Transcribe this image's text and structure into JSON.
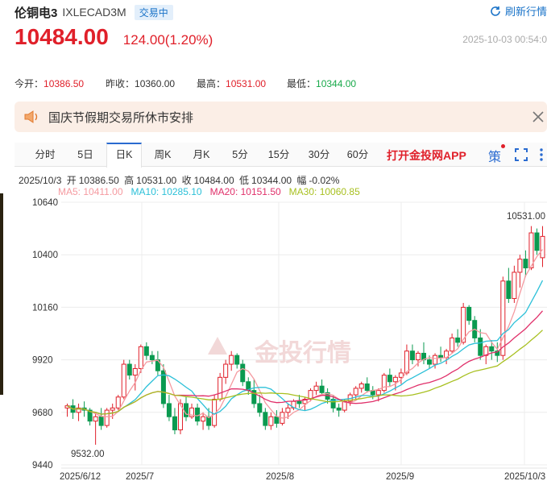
{
  "header": {
    "name": "伦铜电3",
    "code": "IXLECAD3M",
    "status": "交易中",
    "refresh_label": "刷新行情"
  },
  "quote": {
    "price": "10484.00",
    "change": "124.00(1.20%)",
    "timestamp": "2025-10-03 00:54:0"
  },
  "stats": [
    {
      "label": "今开：",
      "value": "10386.50",
      "tone": "red"
    },
    {
      "label": "昨收：",
      "value": "10360.00",
      "tone": "dark"
    },
    {
      "label": "最高：",
      "value": "10531.00",
      "tone": "red"
    },
    {
      "label": "最低：",
      "value": "10344.00",
      "tone": "green"
    }
  ],
  "notice": {
    "text": "国庆节假期交易所休市安排"
  },
  "tabs": [
    {
      "label": "分时",
      "active": false
    },
    {
      "label": "5日",
      "active": false
    },
    {
      "label": "日K",
      "active": true
    },
    {
      "label": "周K",
      "active": false
    },
    {
      "label": "月K",
      "active": false
    },
    {
      "label": "5分",
      "active": false
    },
    {
      "label": "15分",
      "active": false
    },
    {
      "label": "30分",
      "active": false
    },
    {
      "label": "60分",
      "active": false
    }
  ],
  "toolbar": {
    "app_link": "打开金投网APP",
    "strategy_label": "策"
  },
  "ohlc": {
    "date": "2025/10/3",
    "open_label": "开",
    "open": "10386.50",
    "high_label": "高",
    "high": "10531.00",
    "close_label": "收",
    "close": "10484.00",
    "low_label": "低",
    "low": "10344.00",
    "range_label": "幅",
    "range": "-0.02%"
  },
  "ma": [
    {
      "text": "MA5: 10411.00",
      "color": "#f59aa0"
    },
    {
      "text": "MA10: 10285.10",
      "color": "#2bc0d8"
    },
    {
      "text": "MA20: 10151.50",
      "color": "#e0306a"
    },
    {
      "text": "MA30: 10060.85",
      "color": "#a8c020"
    }
  ],
  "watermark": "金投行情",
  "colors": {
    "up": "#e0202a",
    "down": "#0a9a50",
    "accent": "#2a6bd0"
  },
  "chart_data": {
    "type": "candlestick",
    "ylim": [
      9440,
      10640
    ],
    "y_ticks": [
      10640,
      10400,
      10160,
      9920,
      9680,
      9440
    ],
    "x_ticks": [
      "2025/6/12",
      "2025/7",
      "2025/8",
      "2025/9",
      "2025/10/3"
    ],
    "max_label": "10531.00",
    "min_label": "9532.00",
    "candles": [
      [
        9700,
        9720,
        9660,
        9710
      ],
      [
        9710,
        9740,
        9650,
        9680
      ],
      [
        9680,
        9720,
        9640,
        9700
      ],
      [
        9700,
        9730,
        9660,
        9690
      ],
      [
        9690,
        9700,
        9620,
        9640
      ],
      [
        9640,
        9680,
        9532,
        9660
      ],
      [
        9660,
        9700,
        9600,
        9620
      ],
      [
        9620,
        9700,
        9610,
        9690
      ],
      [
        9690,
        9720,
        9650,
        9700
      ],
      [
        9700,
        9760,
        9690,
        9750
      ],
      [
        9750,
        9920,
        9740,
        9900
      ],
      [
        9900,
        9920,
        9830,
        9850
      ],
      [
        9850,
        9900,
        9780,
        9880
      ],
      [
        9880,
        9990,
        9860,
        9980
      ],
      [
        9980,
        10000,
        9920,
        9940
      ],
      [
        9940,
        9960,
        9900,
        9920
      ],
      [
        9920,
        9960,
        9850,
        9870
      ],
      [
        9870,
        9900,
        9700,
        9720
      ],
      [
        9720,
        9760,
        9640,
        9660
      ],
      [
        9660,
        9700,
        9580,
        9600
      ],
      [
        9600,
        9740,
        9580,
        9720
      ],
      [
        9720,
        9750,
        9640,
        9660
      ],
      [
        9660,
        9720,
        9650,
        9700
      ],
      [
        9700,
        9720,
        9620,
        9640
      ],
      [
        9640,
        9680,
        9600,
        9660
      ],
      [
        9660,
        9700,
        9600,
        9620
      ],
      [
        9620,
        9760,
        9610,
        9740
      ],
      [
        9740,
        9860,
        9730,
        9840
      ],
      [
        9840,
        9920,
        9810,
        9900
      ],
      [
        9900,
        9960,
        9870,
        9940
      ],
      [
        9940,
        9950,
        9880,
        9900
      ],
      [
        9900,
        9920,
        9800,
        9820
      ],
      [
        9820,
        9840,
        9760,
        9780
      ],
      [
        9780,
        9830,
        9700,
        9720
      ],
      [
        9720,
        9760,
        9660,
        9680
      ],
      [
        9680,
        9700,
        9600,
        9620
      ],
      [
        9620,
        9680,
        9600,
        9660
      ],
      [
        9660,
        9690,
        9610,
        9630
      ],
      [
        9630,
        9700,
        9620,
        9680
      ],
      [
        9680,
        9720,
        9650,
        9700
      ],
      [
        9700,
        9740,
        9690,
        9730
      ],
      [
        9730,
        9760,
        9700,
        9720
      ],
      [
        9720,
        9750,
        9690,
        9740
      ],
      [
        9740,
        9790,
        9730,
        9780
      ],
      [
        9780,
        9820,
        9760,
        9800
      ],
      [
        9800,
        9830,
        9760,
        9770
      ],
      [
        9770,
        9790,
        9720,
        9740
      ],
      [
        9740,
        9760,
        9680,
        9700
      ],
      [
        9700,
        9720,
        9660,
        9690
      ],
      [
        9690,
        9740,
        9680,
        9730
      ],
      [
        9730,
        9770,
        9710,
        9760
      ],
      [
        9760,
        9800,
        9740,
        9790
      ],
      [
        9790,
        9820,
        9770,
        9810
      ],
      [
        9810,
        9840,
        9770,
        9780
      ],
      [
        9780,
        9800,
        9740,
        9760
      ],
      [
        9760,
        9790,
        9730,
        9780
      ],
      [
        9780,
        9860,
        9770,
        9850
      ],
      [
        9850,
        9880,
        9800,
        9820
      ],
      [
        9820,
        9850,
        9780,
        9840
      ],
      [
        9840,
        9880,
        9810,
        9860
      ],
      [
        9860,
        9990,
        9850,
        9960
      ],
      [
        9960,
        9990,
        9900,
        9920
      ],
      [
        9920,
        9960,
        9890,
        9950
      ],
      [
        9950,
        10000,
        9900,
        9920
      ],
      [
        9920,
        9940,
        9880,
        9900
      ],
      [
        9900,
        9950,
        9880,
        9940
      ],
      [
        9940,
        9980,
        9910,
        9930
      ],
      [
        9930,
        9970,
        9900,
        9960
      ],
      [
        9960,
        10040,
        9950,
        10020
      ],
      [
        10020,
        10060,
        9980,
        10000
      ],
      [
        10000,
        10180,
        9990,
        10160
      ],
      [
        10160,
        10170,
        10080,
        10100
      ],
      [
        10100,
        10120,
        10000,
        10020
      ],
      [
        10020,
        10060,
        9920,
        9940
      ],
      [
        9940,
        9990,
        9900,
        9980
      ],
      [
        9980,
        10010,
        9920,
        9960
      ],
      [
        9960,
        10000,
        9910,
        9940
      ],
      [
        9940,
        10300,
        9920,
        10280
      ],
      [
        10280,
        10340,
        10180,
        10200
      ],
      [
        10200,
        10350,
        10180,
        10320
      ],
      [
        10320,
        10400,
        10250,
        10380
      ],
      [
        10380,
        10420,
        10300,
        10340
      ],
      [
        10340,
        10531,
        10330,
        10500
      ],
      [
        10500,
        10520,
        10400,
        10420
      ],
      [
        10386.5,
        10531,
        10344,
        10484
      ]
    ]
  }
}
